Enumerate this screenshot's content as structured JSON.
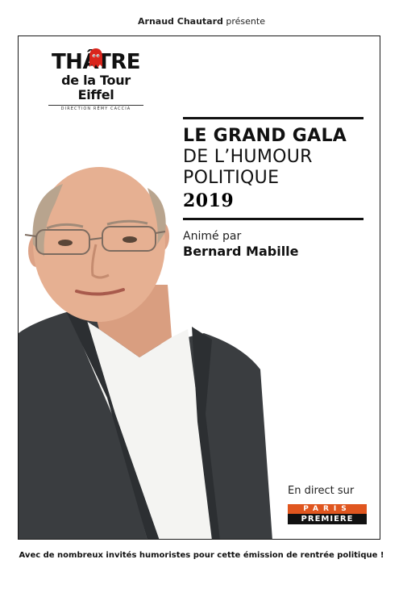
{
  "presenter": {
    "name": "Arnaud Chautard",
    "verb": "présente"
  },
  "logo": {
    "line1_a": "TH",
    "line1_b": "ÂTRE",
    "line2": "de la Tour Eiffel",
    "line3": "DIRECTION RÉMY CACCIA"
  },
  "title": {
    "line1": "LE GRAND GALA",
    "line2": "DE L’HUMOUR",
    "line3": "POLITIQUE",
    "year": "2019"
  },
  "host": {
    "label": "Animé par",
    "name": "Bernard Mabille"
  },
  "broadcast": {
    "label": "En direct sur",
    "channel_top": "PARIS",
    "channel_bottom": "PREMIERE"
  },
  "tagline": "Avec de nombreux invités humoristes  pour cette émission de rentrée politique !",
  "colors": {
    "channel_orange": "#e0561f",
    "jacket": "#3a3d40",
    "shirt": "#f4f4f2",
    "skin": "#e6b092"
  }
}
